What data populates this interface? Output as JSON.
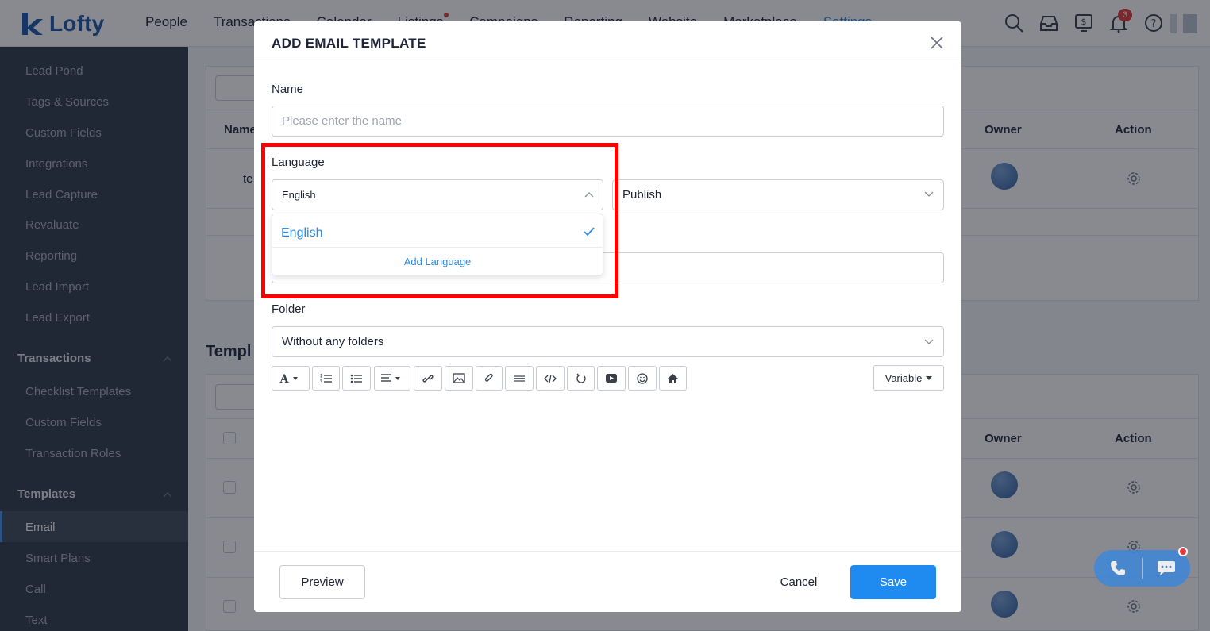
{
  "brand": {
    "name": "Lofty",
    "logo_color": "#1c56a8"
  },
  "topnav": {
    "items": [
      "People",
      "Transactions",
      "Calendar",
      "Listings",
      "Campaigns",
      "Reporting",
      "Website",
      "Marketplace",
      "Settings"
    ],
    "active": "Settings",
    "notification_count": "3",
    "icons": [
      "search-icon",
      "inbox-icon",
      "dollar-monitor-icon",
      "bell-icon",
      "help-icon"
    ]
  },
  "sidebar": {
    "items_top": [
      "Lead Pond",
      "Tags & Sources",
      "Custom Fields",
      "Integrations",
      "Lead Capture",
      "Revaluate",
      "Reporting",
      "Lead Import",
      "Lead Export"
    ],
    "sections": [
      {
        "title": "Transactions",
        "items": [
          "Checklist Templates",
          "Custom Fields",
          "Transaction Roles"
        ]
      },
      {
        "title": "Templates",
        "items": [
          "Email",
          "Smart Plans",
          "Call",
          "Text"
        ]
      }
    ],
    "active_item": "Email"
  },
  "background": {
    "table1": {
      "col_name": "Name",
      "col_owner": "Owner",
      "col_action": "Action",
      "row1_name": "te"
    },
    "section2_title": "Templ",
    "table2": {
      "col_owner": "Owner",
      "col_action": "Action"
    }
  },
  "modal": {
    "title": "ADD EMAIL TEMPLATE",
    "name_label": "Name",
    "name_placeholder": "Please enter the name",
    "language_label": "Language",
    "language_value": "English",
    "language_options": [
      {
        "label": "English",
        "selected": true
      }
    ],
    "add_language": "Add Language",
    "status_value": "Publish",
    "folder_label": "Folder",
    "folder_value": "Without any folders",
    "toolbar": [
      "font-color-icon",
      "ordered-list-icon",
      "bullet-list-icon",
      "align-icon",
      "link-icon",
      "image-icon",
      "attachment-icon",
      "horizontal-rule-icon",
      "code-icon",
      "undo-icon",
      "video-icon",
      "emoji-icon",
      "home-icon"
    ],
    "variable_button": "Variable",
    "preview_button": "Preview",
    "cancel_button": "Cancel",
    "save_button": "Save"
  },
  "colors": {
    "accent": "#1f8bf0",
    "highlight": "#ff0000",
    "sidebar_bg": "#2f3848"
  }
}
